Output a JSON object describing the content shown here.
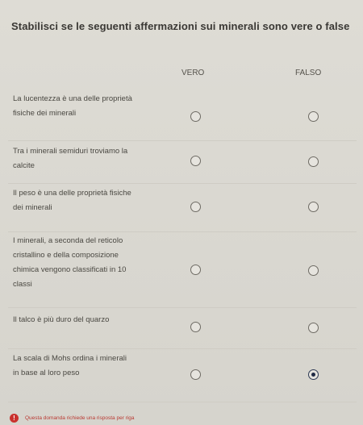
{
  "question": "Stabilisci se le seguenti affermazioni sui minerali sono vere o false",
  "columns": {
    "true_label": "VERO",
    "false_label": "FALSO"
  },
  "statements": [
    {
      "text": "La lucentezza è una delle proprietà fisiche dei minerali",
      "selected": "none"
    },
    {
      "text": "Tra i minerali semiduri troviamo la calcite",
      "selected": "none"
    },
    {
      "text": "Il peso è una delle proprietà fisiche dei minerali",
      "selected": "none"
    },
    {
      "text": "I minerali, a seconda del reticolo cristallino e della composizione chimica vengono classificati in 10 classi",
      "selected": "none"
    },
    {
      "text": "Il talco è più duro del quarzo",
      "selected": "none"
    },
    {
      "text": "La scala di Mohs ordina i minerali in base al loro peso",
      "selected": "false"
    }
  ],
  "footer": {
    "icon": "exclamation-icon",
    "text": "Questa domanda richiede una risposta per riga",
    "color": "#c9302c"
  }
}
